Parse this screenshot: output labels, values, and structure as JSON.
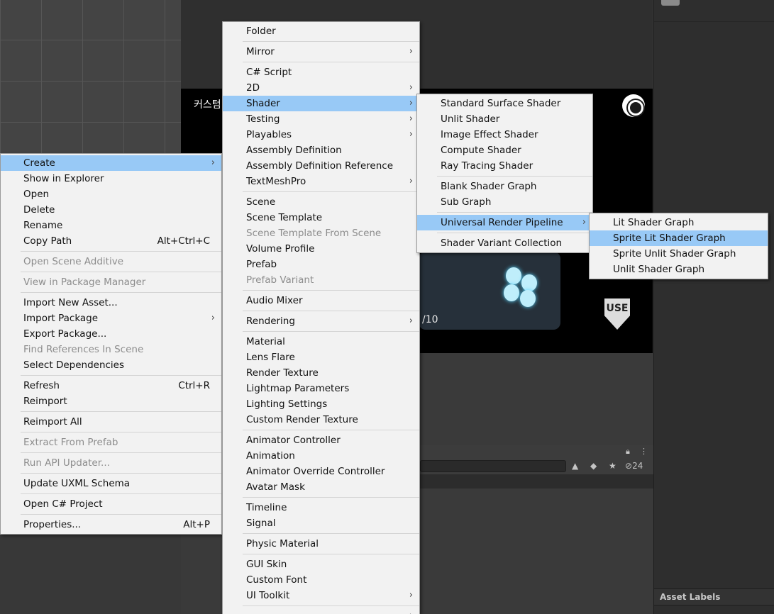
{
  "game_view": {
    "title": "커스텀",
    "counter_text": "/10",
    "badge_text": "USE"
  },
  "toolbar": {
    "hidden_count": "24"
  },
  "right_panel": {
    "asset_labels": "Asset Labels"
  },
  "main_menu": [
    {
      "type": "item",
      "label": "Create",
      "arrow": true,
      "highlighted": true
    },
    {
      "type": "item",
      "label": "Show in Explorer"
    },
    {
      "type": "item",
      "label": "Open"
    },
    {
      "type": "item",
      "label": "Delete"
    },
    {
      "type": "item",
      "label": "Rename"
    },
    {
      "type": "item",
      "label": "Copy Path",
      "shortcut": "Alt+Ctrl+C"
    },
    {
      "type": "sep"
    },
    {
      "type": "item",
      "label": "Open Scene Additive",
      "disabled": true
    },
    {
      "type": "sep"
    },
    {
      "type": "item",
      "label": "View in Package Manager",
      "disabled": true
    },
    {
      "type": "sep"
    },
    {
      "type": "item",
      "label": "Import New Asset..."
    },
    {
      "type": "item",
      "label": "Import Package",
      "arrow": true
    },
    {
      "type": "item",
      "label": "Export Package..."
    },
    {
      "type": "item",
      "label": "Find References In Scene",
      "disabled": true
    },
    {
      "type": "item",
      "label": "Select Dependencies"
    },
    {
      "type": "sep"
    },
    {
      "type": "item",
      "label": "Refresh",
      "shortcut": "Ctrl+R"
    },
    {
      "type": "item",
      "label": "Reimport"
    },
    {
      "type": "sep"
    },
    {
      "type": "item",
      "label": "Reimport All"
    },
    {
      "type": "sep"
    },
    {
      "type": "item",
      "label": "Extract From Prefab",
      "disabled": true
    },
    {
      "type": "sep"
    },
    {
      "type": "item",
      "label": "Run API Updater...",
      "disabled": true
    },
    {
      "type": "sep"
    },
    {
      "type": "item",
      "label": "Update UXML Schema"
    },
    {
      "type": "sep"
    },
    {
      "type": "item",
      "label": "Open C# Project"
    },
    {
      "type": "sep"
    },
    {
      "type": "item",
      "label": "Properties...",
      "shortcut": "Alt+P"
    }
  ],
  "create_menu": [
    {
      "type": "item",
      "label": "Folder"
    },
    {
      "type": "sep"
    },
    {
      "type": "item",
      "label": "Mirror",
      "arrow": true
    },
    {
      "type": "sep"
    },
    {
      "type": "item",
      "label": "C# Script"
    },
    {
      "type": "item",
      "label": "2D",
      "arrow": true
    },
    {
      "type": "item",
      "label": "Shader",
      "arrow": true,
      "highlighted": true
    },
    {
      "type": "item",
      "label": "Testing",
      "arrow": true
    },
    {
      "type": "item",
      "label": "Playables",
      "arrow": true
    },
    {
      "type": "item",
      "label": "Assembly Definition"
    },
    {
      "type": "item",
      "label": "Assembly Definition Reference"
    },
    {
      "type": "item",
      "label": "TextMeshPro",
      "arrow": true
    },
    {
      "type": "sep"
    },
    {
      "type": "item",
      "label": "Scene"
    },
    {
      "type": "item",
      "label": "Scene Template"
    },
    {
      "type": "item",
      "label": "Scene Template From Scene",
      "disabled": true
    },
    {
      "type": "item",
      "label": "Volume Profile"
    },
    {
      "type": "item",
      "label": "Prefab"
    },
    {
      "type": "item",
      "label": "Prefab Variant",
      "disabled": true
    },
    {
      "type": "sep"
    },
    {
      "type": "item",
      "label": "Audio Mixer"
    },
    {
      "type": "sep"
    },
    {
      "type": "item",
      "label": "Rendering",
      "arrow": true
    },
    {
      "type": "sep"
    },
    {
      "type": "item",
      "label": "Material"
    },
    {
      "type": "item",
      "label": "Lens Flare"
    },
    {
      "type": "item",
      "label": "Render Texture"
    },
    {
      "type": "item",
      "label": "Lightmap Parameters"
    },
    {
      "type": "item",
      "label": "Lighting Settings"
    },
    {
      "type": "item",
      "label": "Custom Render Texture"
    },
    {
      "type": "sep"
    },
    {
      "type": "item",
      "label": "Animator Controller"
    },
    {
      "type": "item",
      "label": "Animation"
    },
    {
      "type": "item",
      "label": "Animator Override Controller"
    },
    {
      "type": "item",
      "label": "Avatar Mask"
    },
    {
      "type": "sep"
    },
    {
      "type": "item",
      "label": "Timeline"
    },
    {
      "type": "item",
      "label": "Signal"
    },
    {
      "type": "sep"
    },
    {
      "type": "item",
      "label": "Physic Material"
    },
    {
      "type": "sep"
    },
    {
      "type": "item",
      "label": "GUI Skin"
    },
    {
      "type": "item",
      "label": "Custom Font"
    },
    {
      "type": "item",
      "label": "UI Toolkit",
      "arrow": true
    },
    {
      "type": "sep"
    },
    {
      "type": "item",
      "label": "",
      "arrow": true
    }
  ],
  "shader_menu": [
    {
      "type": "item",
      "label": "Standard Surface Shader"
    },
    {
      "type": "item",
      "label": "Unlit Shader"
    },
    {
      "type": "item",
      "label": "Image Effect Shader"
    },
    {
      "type": "item",
      "label": "Compute Shader"
    },
    {
      "type": "item",
      "label": "Ray Tracing Shader"
    },
    {
      "type": "sep"
    },
    {
      "type": "item",
      "label": "Blank Shader Graph"
    },
    {
      "type": "item",
      "label": "Sub Graph"
    },
    {
      "type": "sep"
    },
    {
      "type": "item",
      "label": "Universal Render Pipeline",
      "arrow": true,
      "highlighted": true
    },
    {
      "type": "sep"
    },
    {
      "type": "item",
      "label": "Shader Variant Collection"
    }
  ],
  "urp_menu": [
    {
      "type": "item",
      "label": "Lit Shader Graph"
    },
    {
      "type": "item",
      "label": "Sprite Lit Shader Graph",
      "highlighted": true
    },
    {
      "type": "item",
      "label": "Sprite Unlit Shader Graph"
    },
    {
      "type": "item",
      "label": "Unlit Shader Graph"
    }
  ]
}
